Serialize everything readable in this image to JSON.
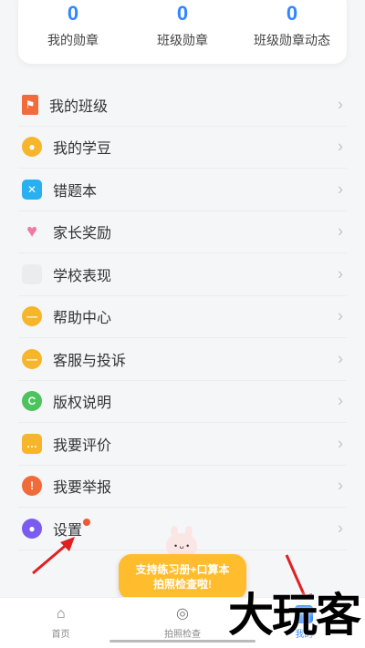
{
  "stats": [
    {
      "value": "0",
      "label": "我的勋章"
    },
    {
      "value": "0",
      "label": "班级勋章"
    },
    {
      "value": "0",
      "label": "班级勋章动态"
    }
  ],
  "menu": [
    {
      "label": "我的班级",
      "icon": "flag-icon",
      "color": "#f26b3a"
    },
    {
      "label": "我的学豆",
      "icon": "bean-icon",
      "color": "#f7b52c"
    },
    {
      "label": "错题本",
      "icon": "notebook-icon",
      "color": "#28b0f0"
    },
    {
      "label": "家长奖励",
      "icon": "heart-icon",
      "color": "#f07aa0"
    },
    {
      "label": "学校表现",
      "icon": "school-icon",
      "color": "#ececec"
    },
    {
      "label": "帮助中心",
      "icon": "help-icon",
      "color": "#f7b52c"
    },
    {
      "label": "客服与投诉",
      "icon": "service-icon",
      "color": "#f7b52c"
    },
    {
      "label": "版权说明",
      "icon": "copyright-icon",
      "color": "#4cc35c"
    },
    {
      "label": "我要评价",
      "icon": "comment-icon",
      "color": "#f7b52c"
    },
    {
      "label": "我要举报",
      "icon": "report-icon",
      "color": "#f06a3a"
    },
    {
      "label": "设置",
      "icon": "settings-icon",
      "color": "#7a5cf0"
    }
  ],
  "promo": {
    "line1": "支持练习册+口算本",
    "line2": "拍照检查啦!"
  },
  "tabs": [
    {
      "label": "首页",
      "icon": "home-icon"
    },
    {
      "label": "拍照检查",
      "icon": "camera-icon"
    },
    {
      "label": "我的",
      "icon": "profile-icon"
    }
  ],
  "watermark": "大玩客"
}
